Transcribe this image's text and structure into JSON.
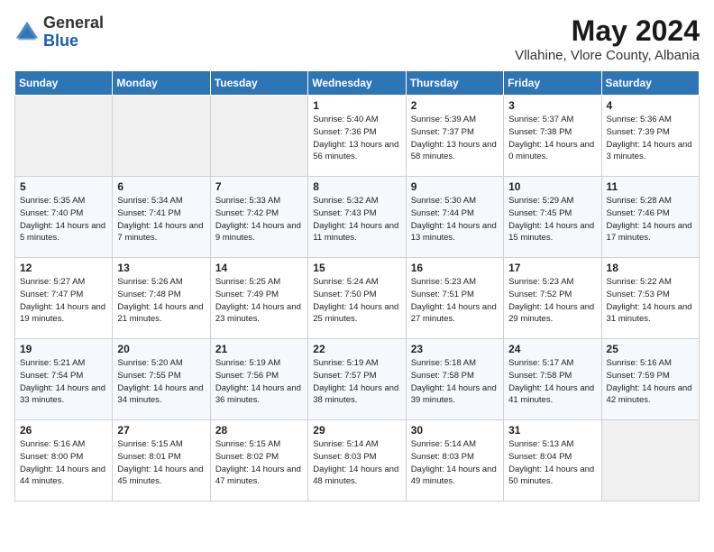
{
  "header": {
    "logo_general": "General",
    "logo_blue": "Blue",
    "month_title": "May 2024",
    "location": "Vllahine, Vlore County, Albania"
  },
  "weekdays": [
    "Sunday",
    "Monday",
    "Tuesday",
    "Wednesday",
    "Thursday",
    "Friday",
    "Saturday"
  ],
  "weeks": [
    [
      {
        "day": "",
        "empty": true
      },
      {
        "day": "",
        "empty": true
      },
      {
        "day": "",
        "empty": true
      },
      {
        "day": "1",
        "sunrise": "Sunrise: 5:40 AM",
        "sunset": "Sunset: 7:36 PM",
        "daylight": "Daylight: 13 hours and 56 minutes."
      },
      {
        "day": "2",
        "sunrise": "Sunrise: 5:39 AM",
        "sunset": "Sunset: 7:37 PM",
        "daylight": "Daylight: 13 hours and 58 minutes."
      },
      {
        "day": "3",
        "sunrise": "Sunrise: 5:37 AM",
        "sunset": "Sunset: 7:38 PM",
        "daylight": "Daylight: 14 hours and 0 minutes."
      },
      {
        "day": "4",
        "sunrise": "Sunrise: 5:36 AM",
        "sunset": "Sunset: 7:39 PM",
        "daylight": "Daylight: 14 hours and 3 minutes."
      }
    ],
    [
      {
        "day": "5",
        "sunrise": "Sunrise: 5:35 AM",
        "sunset": "Sunset: 7:40 PM",
        "daylight": "Daylight: 14 hours and 5 minutes."
      },
      {
        "day": "6",
        "sunrise": "Sunrise: 5:34 AM",
        "sunset": "Sunset: 7:41 PM",
        "daylight": "Daylight: 14 hours and 7 minutes."
      },
      {
        "day": "7",
        "sunrise": "Sunrise: 5:33 AM",
        "sunset": "Sunset: 7:42 PM",
        "daylight": "Daylight: 14 hours and 9 minutes."
      },
      {
        "day": "8",
        "sunrise": "Sunrise: 5:32 AM",
        "sunset": "Sunset: 7:43 PM",
        "daylight": "Daylight: 14 hours and 11 minutes."
      },
      {
        "day": "9",
        "sunrise": "Sunrise: 5:30 AM",
        "sunset": "Sunset: 7:44 PM",
        "daylight": "Daylight: 14 hours and 13 minutes."
      },
      {
        "day": "10",
        "sunrise": "Sunrise: 5:29 AM",
        "sunset": "Sunset: 7:45 PM",
        "daylight": "Daylight: 14 hours and 15 minutes."
      },
      {
        "day": "11",
        "sunrise": "Sunrise: 5:28 AM",
        "sunset": "Sunset: 7:46 PM",
        "daylight": "Daylight: 14 hours and 17 minutes."
      }
    ],
    [
      {
        "day": "12",
        "sunrise": "Sunrise: 5:27 AM",
        "sunset": "Sunset: 7:47 PM",
        "daylight": "Daylight: 14 hours and 19 minutes."
      },
      {
        "day": "13",
        "sunrise": "Sunrise: 5:26 AM",
        "sunset": "Sunset: 7:48 PM",
        "daylight": "Daylight: 14 hours and 21 minutes."
      },
      {
        "day": "14",
        "sunrise": "Sunrise: 5:25 AM",
        "sunset": "Sunset: 7:49 PM",
        "daylight": "Daylight: 14 hours and 23 minutes."
      },
      {
        "day": "15",
        "sunrise": "Sunrise: 5:24 AM",
        "sunset": "Sunset: 7:50 PM",
        "daylight": "Daylight: 14 hours and 25 minutes."
      },
      {
        "day": "16",
        "sunrise": "Sunrise: 5:23 AM",
        "sunset": "Sunset: 7:51 PM",
        "daylight": "Daylight: 14 hours and 27 minutes."
      },
      {
        "day": "17",
        "sunrise": "Sunrise: 5:23 AM",
        "sunset": "Sunset: 7:52 PM",
        "daylight": "Daylight: 14 hours and 29 minutes."
      },
      {
        "day": "18",
        "sunrise": "Sunrise: 5:22 AM",
        "sunset": "Sunset: 7:53 PM",
        "daylight": "Daylight: 14 hours and 31 minutes."
      }
    ],
    [
      {
        "day": "19",
        "sunrise": "Sunrise: 5:21 AM",
        "sunset": "Sunset: 7:54 PM",
        "daylight": "Daylight: 14 hours and 33 minutes."
      },
      {
        "day": "20",
        "sunrise": "Sunrise: 5:20 AM",
        "sunset": "Sunset: 7:55 PM",
        "daylight": "Daylight: 14 hours and 34 minutes."
      },
      {
        "day": "21",
        "sunrise": "Sunrise: 5:19 AM",
        "sunset": "Sunset: 7:56 PM",
        "daylight": "Daylight: 14 hours and 36 minutes."
      },
      {
        "day": "22",
        "sunrise": "Sunrise: 5:19 AM",
        "sunset": "Sunset: 7:57 PM",
        "daylight": "Daylight: 14 hours and 38 minutes."
      },
      {
        "day": "23",
        "sunrise": "Sunrise: 5:18 AM",
        "sunset": "Sunset: 7:58 PM",
        "daylight": "Daylight: 14 hours and 39 minutes."
      },
      {
        "day": "24",
        "sunrise": "Sunrise: 5:17 AM",
        "sunset": "Sunset: 7:58 PM",
        "daylight": "Daylight: 14 hours and 41 minutes."
      },
      {
        "day": "25",
        "sunrise": "Sunrise: 5:16 AM",
        "sunset": "Sunset: 7:59 PM",
        "daylight": "Daylight: 14 hours and 42 minutes."
      }
    ],
    [
      {
        "day": "26",
        "sunrise": "Sunrise: 5:16 AM",
        "sunset": "Sunset: 8:00 PM",
        "daylight": "Daylight: 14 hours and 44 minutes."
      },
      {
        "day": "27",
        "sunrise": "Sunrise: 5:15 AM",
        "sunset": "Sunset: 8:01 PM",
        "daylight": "Daylight: 14 hours and 45 minutes."
      },
      {
        "day": "28",
        "sunrise": "Sunrise: 5:15 AM",
        "sunset": "Sunset: 8:02 PM",
        "daylight": "Daylight: 14 hours and 47 minutes."
      },
      {
        "day": "29",
        "sunrise": "Sunrise: 5:14 AM",
        "sunset": "Sunset: 8:03 PM",
        "daylight": "Daylight: 14 hours and 48 minutes."
      },
      {
        "day": "30",
        "sunrise": "Sunrise: 5:14 AM",
        "sunset": "Sunset: 8:03 PM",
        "daylight": "Daylight: 14 hours and 49 minutes."
      },
      {
        "day": "31",
        "sunrise": "Sunrise: 5:13 AM",
        "sunset": "Sunset: 8:04 PM",
        "daylight": "Daylight: 14 hours and 50 minutes."
      },
      {
        "day": "",
        "empty": true
      }
    ]
  ]
}
